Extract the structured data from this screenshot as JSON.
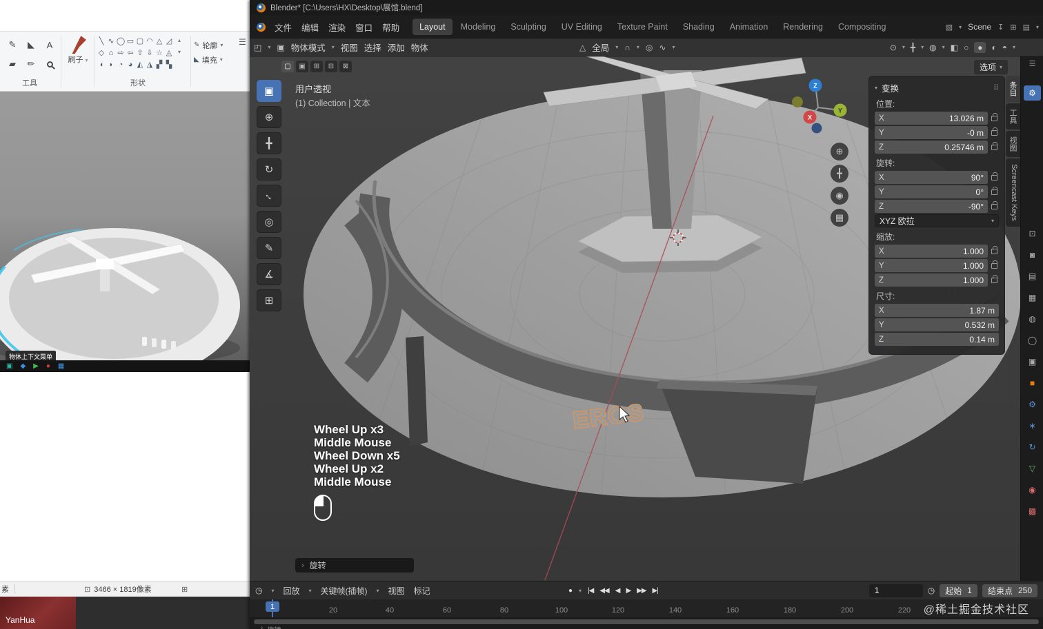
{
  "paint": {
    "section_labels": {
      "tools": "工具",
      "shapes": "形状"
    },
    "brush_label": "刷子",
    "outline_label": "轮廓",
    "fill_label": "填充",
    "tool_glyphs": [
      "✎",
      "◣",
      "A",
      "▰",
      "✏"
    ],
    "shape_glyphs": [
      "╲",
      "∿",
      "◯",
      "▭",
      "▢",
      "◠",
      "△",
      "◿",
      "◇",
      "⌂",
      "⇨",
      "⇦",
      "⇧",
      "⇩",
      "☆",
      "◬",
      "◖",
      "◗",
      "◔",
      "◕",
      "◭",
      "◮",
      "▞",
      "▚"
    ],
    "overlay_tooltip": "物体上下文菜单",
    "status": {
      "partial": "素",
      "dimensions": "3466 × 1819像素"
    },
    "taskbar_label": "YanHua"
  },
  "blender": {
    "title": "Blender* [C:\\Users\\HX\\Desktop\\展馆.blend]",
    "menus": [
      "文件",
      "编辑",
      "渲染",
      "窗口",
      "帮助"
    ],
    "workspaces": [
      "Layout",
      "Modeling",
      "Sculpting",
      "UV Editing",
      "Texture Paint",
      "Shading",
      "Animation",
      "Rendering",
      "Compositing"
    ],
    "scene": "Scene",
    "header": {
      "mode": "物体模式",
      "view": "视图",
      "select": "选择",
      "add": "添加",
      "object": "物体",
      "orientation": "全局",
      "options": "选项"
    },
    "viewport": {
      "perspective": "用户透视",
      "collection": "(1) Collection | 文本",
      "text_object": "EROS",
      "axis_x": "X",
      "axis_y": "Y",
      "axis_z": "Z"
    },
    "tools": [
      "▣",
      "⊕",
      "╋",
      "↻",
      "↔",
      "◎",
      "✎",
      "∡",
      "⊞"
    ],
    "tool_opts": [
      "▢",
      "▣",
      "⊞",
      "⊟",
      "⊠"
    ],
    "npanel": {
      "title": "变换",
      "tabs": [
        "条目",
        "工具",
        "视图",
        "Screencast Keys"
      ],
      "location_label": "位置:",
      "rotation_label": "旋转:",
      "scale_label": "缩放:",
      "dimensions_label": "尺寸:",
      "euler": "XYZ 欧拉",
      "axis": {
        "x": "X",
        "y": "Y",
        "z": "Z"
      },
      "location": {
        "x": "13.026 m",
        "y": "-0 m",
        "z": "0.25746 m"
      },
      "rotation": {
        "x": "90°",
        "y": "0°",
        "z": "-90°"
      },
      "scale": {
        "x": "1.000",
        "y": "1.000",
        "z": "1.000"
      },
      "dimensions": {
        "x": "1.87 m",
        "y": "0.532 m",
        "z": "0.14 m"
      }
    },
    "screencast": {
      "lines": [
        "Wheel Up x3",
        "Middle Mouse",
        "Wheel Down x5",
        "Wheel Up x2",
        "Middle Mouse"
      ]
    },
    "operator": "旋转",
    "timeline": {
      "menus": [
        "回放",
        "关键帧(插帧)",
        "视图",
        "标记"
      ],
      "current_frame": "1",
      "start_label": "起始",
      "start_value": "1",
      "end_label": "结束点",
      "end_value": "250",
      "ticks": [
        "20",
        "40",
        "60",
        "80",
        "100",
        "120",
        "140",
        "160",
        "180",
        "200",
        "220"
      ],
      "playhead": "1"
    },
    "status_hint": "旋转",
    "watermark": "@稀土掘金技术社区"
  },
  "icons": {
    "caret": "▾",
    "chevron": "›",
    "hamburger": "☰",
    "grid_dots": "⠿",
    "scroll_up": "▴",
    "scroll_down": "▾",
    "sel_rect": "⊡",
    "display": "⊞",
    "editor_3d": "◰",
    "mode": "▣",
    "orientation": "△",
    "magnet": "∩",
    "proportional": "◎",
    "falloff": "∿",
    "eye": "⊙",
    "gizmo_toggle": "╋",
    "overlays": "◍",
    "xray": "◧",
    "shade_wire": "○",
    "shade_solid": "●",
    "shade_material": "◐",
    "shade_render": "◓",
    "scene": "▧",
    "pin": "↧",
    "copy": "⊞",
    "viewlayer": "▤",
    "zoom_in": "⊕",
    "pan_hand": "╋",
    "camera_view": "◉",
    "ortho_grid": "▦",
    "clock": "◷",
    "record": "●",
    "jump_start": "|◀",
    "prev_key": "◀◀",
    "play_back": "◀",
    "play": "▶",
    "next_key": "▶▶",
    "jump_end": "▶|",
    "props": [
      "⚙",
      "⊡",
      "◙",
      "▤",
      "▦",
      "◍",
      "◯",
      "▣",
      "■",
      "⚙",
      "∗",
      "↻",
      "▽",
      "◉",
      "▩"
    ],
    "mini": [
      "▣",
      "◆",
      "▶",
      "●",
      "▦"
    ]
  },
  "colors": {
    "accent_blue": "#4772b3",
    "selection_orange": "#e8944d",
    "object_orange": "#e87d0d",
    "modifier_blue": "#5a8fd6",
    "data_green": "#6fbf6f",
    "material_red": "#d66a6a",
    "cyan_accent": "#41c7ec"
  }
}
